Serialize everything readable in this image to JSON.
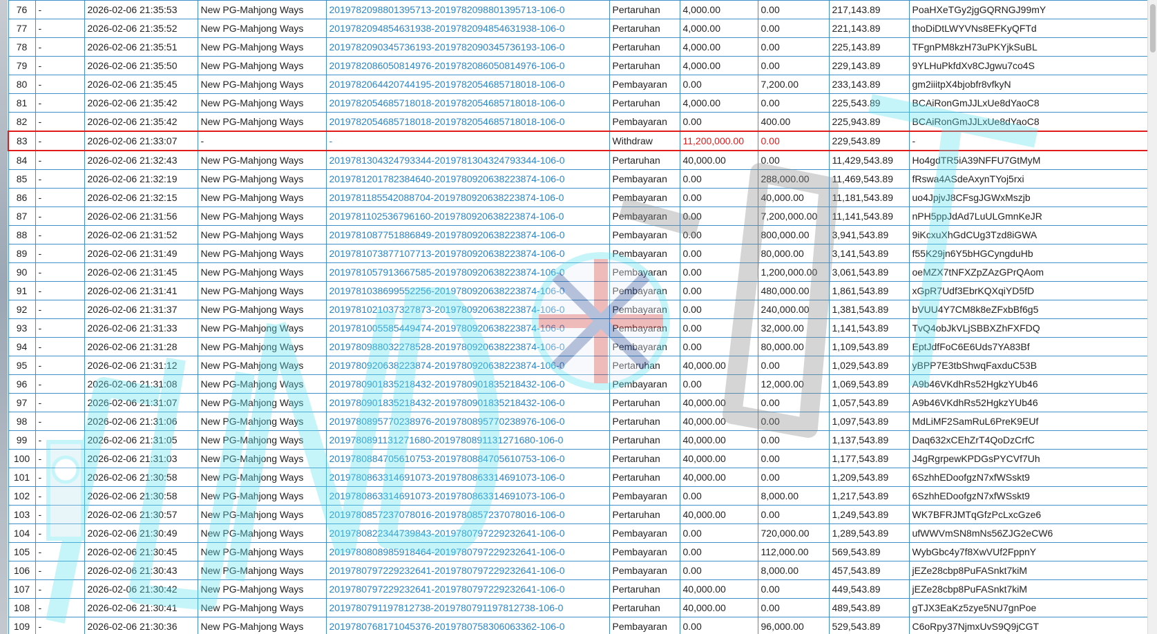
{
  "colors": {
    "border": "#3f8fc8",
    "link": "#2a86c8",
    "highlight": "#e01b1b",
    "watermark_fill": "#5fe3f0",
    "watermark_dark": "#7a7a7a"
  },
  "watermark": {
    "flag_icon": "union-jack-icon",
    "tower_icon": "big-ben-icon"
  },
  "rows": [
    {
      "no": "76",
      "f": "-",
      "dt": "2026-02-06 21:35:53",
      "game": "New PG-Mahjong Ways",
      "ref": "2019782098801395713-2019782098801395713-106-0",
      "type": "Pertaruhan",
      "debit": "4,000.00",
      "credit": "0.00",
      "bal": "217,143.89",
      "code": "PoaHXeTGy2jgGQRNGJ99mY"
    },
    {
      "no": "77",
      "f": "-",
      "dt": "2026-02-06 21:35:52",
      "game": "New PG-Mahjong Ways",
      "ref": "2019782094854631938-2019782094854631938-106-0",
      "type": "Pertaruhan",
      "debit": "4,000.00",
      "credit": "0.00",
      "bal": "221,143.89",
      "code": "thoDiDtLWYVNs8EFKyQFTd"
    },
    {
      "no": "78",
      "f": "-",
      "dt": "2026-02-06 21:35:51",
      "game": "New PG-Mahjong Ways",
      "ref": "2019782090345736193-2019782090345736193-106-0",
      "type": "Pertaruhan",
      "debit": "4,000.00",
      "credit": "0.00",
      "bal": "225,143.89",
      "code": "TFgnPM8kzH73uPKYjkSuBL"
    },
    {
      "no": "79",
      "f": "-",
      "dt": "2026-02-06 21:35:50",
      "game": "New PG-Mahjong Ways",
      "ref": "2019782086050814976-2019782086050814976-106-0",
      "type": "Pertaruhan",
      "debit": "4,000.00",
      "credit": "0.00",
      "bal": "229,143.89",
      "code": "9YLHuPkfdXv8CJgwu7co4S"
    },
    {
      "no": "80",
      "f": "-",
      "dt": "2026-02-06 21:35:45",
      "game": "New PG-Mahjong Ways",
      "ref": "2019782064420744195-2019782054685718018-106-0",
      "type": "Pembayaran",
      "debit": "0.00",
      "credit": "7,200.00",
      "bal": "233,143.89",
      "code": "gm2iiitpX4bjobfr8vfkyN"
    },
    {
      "no": "81",
      "f": "-",
      "dt": "2026-02-06 21:35:42",
      "game": "New PG-Mahjong Ways",
      "ref": "2019782054685718018-2019782054685718018-106-0",
      "type": "Pertaruhan",
      "debit": "4,000.00",
      "credit": "0.00",
      "bal": "225,543.89",
      "code": "BCAiRonGmJJLxUe8dYaoC8"
    },
    {
      "no": "82",
      "f": "-",
      "dt": "2026-02-06 21:35:42",
      "game": "New PG-Mahjong Ways",
      "ref": "2019782054685718018-2019782054685718018-106-0",
      "type": "Pembayaran",
      "debit": "0.00",
      "credit": "400.00",
      "bal": "225,943.89",
      "code": "BCAiRonGmJJLxUe8dYaoC8"
    },
    {
      "no": "83",
      "f": "-",
      "dt": "2026-02-06 21:33:07",
      "game": "-",
      "ref": "-",
      "type": "Withdraw",
      "debit": "11,200,000.00",
      "credit": "0.00",
      "bal": "229,543.89",
      "code": "-",
      "highlight": true
    },
    {
      "no": "84",
      "f": "-",
      "dt": "2026-02-06 21:32:43",
      "game": "New PG-Mahjong Ways",
      "ref": "2019781304324793344-2019781304324793344-106-0",
      "type": "Pertaruhan",
      "debit": "40,000.00",
      "credit": "0.00",
      "bal": "11,429,543.89",
      "code": "Ho4gdTR5iA39NFFU7GtMyM"
    },
    {
      "no": "85",
      "f": "-",
      "dt": "2026-02-06 21:32:19",
      "game": "New PG-Mahjong Ways",
      "ref": "2019781201782384640-2019780920638223874-106-0",
      "type": "Pembayaran",
      "debit": "0.00",
      "credit": "288,000.00",
      "bal": "11,469,543.89",
      "code": "fRswa4ASdeAxynTYoj5rxi"
    },
    {
      "no": "86",
      "f": "-",
      "dt": "2026-02-06 21:32:15",
      "game": "New PG-Mahjong Ways",
      "ref": "2019781185542088704-2019780920638223874-106-0",
      "type": "Pembayaran",
      "debit": "0.00",
      "credit": "40,000.00",
      "bal": "11,181,543.89",
      "code": "uo4JpjvJ8CFsgJGWxMszjb"
    },
    {
      "no": "87",
      "f": "-",
      "dt": "2026-02-06 21:31:56",
      "game": "New PG-Mahjong Ways",
      "ref": "2019781102536796160-2019780920638223874-106-0",
      "type": "Pembayaran",
      "debit": "0.00",
      "credit": "7,200,000.00",
      "bal": "11,141,543.89",
      "code": "nPH5ppJdAd7LuULGmnKeJR"
    },
    {
      "no": "88",
      "f": "-",
      "dt": "2026-02-06 21:31:52",
      "game": "New PG-Mahjong Ways",
      "ref": "2019781087751886849-2019780920638223874-106-0",
      "type": "Pembayaran",
      "debit": "0.00",
      "credit": "800,000.00",
      "bal": "3,941,543.89",
      "code": "9iKcxuXhGdCUg3Tzd8iGWA"
    },
    {
      "no": "89",
      "f": "-",
      "dt": "2026-02-06 21:31:49",
      "game": "New PG-Mahjong Ways",
      "ref": "2019781073877107713-2019780920638223874-106-0",
      "type": "Pembayaran",
      "debit": "0.00",
      "credit": "80,000.00",
      "bal": "3,141,543.89",
      "code": "f55K29jn6Y5bHGCyngduHb"
    },
    {
      "no": "90",
      "f": "-",
      "dt": "2026-02-06 21:31:45",
      "game": "New PG-Mahjong Ways",
      "ref": "2019781057913667585-2019780920638223874-106-0",
      "type": "Pembayaran",
      "debit": "0.00",
      "credit": "1,200,000.00",
      "bal": "3,061,543.89",
      "code": "oeMZX7tNFXZpZAzGPrQAom"
    },
    {
      "no": "91",
      "f": "-",
      "dt": "2026-02-06 21:31:41",
      "game": "New PG-Mahjong Ways",
      "ref": "2019781038699552256-2019780920638223874-106-0",
      "type": "Pembayaran",
      "debit": "0.00",
      "credit": "480,000.00",
      "bal": "1,861,543.89",
      "code": "xGpR7Udf3EbrKQXqiYD5fD"
    },
    {
      "no": "92",
      "f": "-",
      "dt": "2026-02-06 21:31:37",
      "game": "New PG-Mahjong Ways",
      "ref": "2019781021037327873-2019780920638223874-106-0",
      "type": "Pembayaran",
      "debit": "0.00",
      "credit": "240,000.00",
      "bal": "1,381,543.89",
      "code": "bVUU4Y7CM8k8eZFxbBf6g5"
    },
    {
      "no": "93",
      "f": "-",
      "dt": "2026-02-06 21:31:33",
      "game": "New PG-Mahjong Ways",
      "ref": "2019781005585449474-2019780920638223874-106-0",
      "type": "Pembayaran",
      "debit": "0.00",
      "credit": "32,000.00",
      "bal": "1,141,543.89",
      "code": "TvQ4obJkVLjSBBXZhFXFDQ"
    },
    {
      "no": "94",
      "f": "-",
      "dt": "2026-02-06 21:31:28",
      "game": "New PG-Mahjong Ways",
      "ref": "2019780988032278528-2019780920638223874-106-0",
      "type": "Pembayaran",
      "debit": "0.00",
      "credit": "80,000.00",
      "bal": "1,109,543.89",
      "code": "EptJdfFoC6E6Uds7YA83Bf"
    },
    {
      "no": "95",
      "f": "-",
      "dt": "2026-02-06 21:31:12",
      "game": "New PG-Mahjong Ways",
      "ref": "2019780920638223874-2019780920638223874-106-0",
      "type": "Pertaruhan",
      "debit": "40,000.00",
      "credit": "0.00",
      "bal": "1,029,543.89",
      "code": "yBPP7E3tbShwqFaxduC53B"
    },
    {
      "no": "96",
      "f": "-",
      "dt": "2026-02-06 21:31:08",
      "game": "New PG-Mahjong Ways",
      "ref": "2019780901835218432-2019780901835218432-106-0",
      "type": "Pembayaran",
      "debit": "0.00",
      "credit": "12,000.00",
      "bal": "1,069,543.89",
      "code": "A9b46VKdhRs52HgkzYUb46"
    },
    {
      "no": "97",
      "f": "-",
      "dt": "2026-02-06 21:31:07",
      "game": "New PG-Mahjong Ways",
      "ref": "2019780901835218432-2019780901835218432-106-0",
      "type": "Pertaruhan",
      "debit": "40,000.00",
      "credit": "0.00",
      "bal": "1,057,543.89",
      "code": "A9b46VKdhRs52HgkzYUb46"
    },
    {
      "no": "98",
      "f": "-",
      "dt": "2026-02-06 21:31:06",
      "game": "New PG-Mahjong Ways",
      "ref": "2019780895770238976-2019780895770238976-106-0",
      "type": "Pertaruhan",
      "debit": "40,000.00",
      "credit": "0.00",
      "bal": "1,097,543.89",
      "code": "MdLiMF2SamRuL6PreK9EUf"
    },
    {
      "no": "99",
      "f": "-",
      "dt": "2026-02-06 21:31:05",
      "game": "New PG-Mahjong Ways",
      "ref": "2019780891131271680-2019780891131271680-106-0",
      "type": "Pertaruhan",
      "debit": "40,000.00",
      "credit": "0.00",
      "bal": "1,137,543.89",
      "code": "Daq632xCEhZrT4QoDzCrfC"
    },
    {
      "no": "100",
      "f": "-",
      "dt": "2026-02-06 21:31:03",
      "game": "New PG-Mahjong Ways",
      "ref": "2019780884705610753-2019780884705610753-106-0",
      "type": "Pertaruhan",
      "debit": "40,000.00",
      "credit": "0.00",
      "bal": "1,177,543.89",
      "code": "J4gRgrpewKPDGsPYCVf7Uh"
    },
    {
      "no": "101",
      "f": "-",
      "dt": "2026-02-06 21:30:58",
      "game": "New PG-Mahjong Ways",
      "ref": "2019780863314691073-2019780863314691073-106-0",
      "type": "Pertaruhan",
      "debit": "40,000.00",
      "credit": "0.00",
      "bal": "1,209,543.89",
      "code": "6SzhhEDoofgzN7xfWSskt9"
    },
    {
      "no": "102",
      "f": "-",
      "dt": "2026-02-06 21:30:58",
      "game": "New PG-Mahjong Ways",
      "ref": "2019780863314691073-2019780863314691073-106-0",
      "type": "Pembayaran",
      "debit": "0.00",
      "credit": "8,000.00",
      "bal": "1,217,543.89",
      "code": "6SzhhEDoofgzN7xfWSskt9"
    },
    {
      "no": "103",
      "f": "-",
      "dt": "2026-02-06 21:30:57",
      "game": "New PG-Mahjong Ways",
      "ref": "2019780857237078016-2019780857237078016-106-0",
      "type": "Pertaruhan",
      "debit": "40,000.00",
      "credit": "0.00",
      "bal": "1,249,543.89",
      "code": "WK7BFRJMTqGfzPcLxcGze6"
    },
    {
      "no": "104",
      "f": "-",
      "dt": "2026-02-06 21:30:49",
      "game": "New PG-Mahjong Ways",
      "ref": "2019780822344739843-2019780797229232641-106-0",
      "type": "Pembayaran",
      "debit": "0.00",
      "credit": "720,000.00",
      "bal": "1,289,543.89",
      "code": "ufWWVmSN8mNs56ZJG2eCW6"
    },
    {
      "no": "105",
      "f": "-",
      "dt": "2026-02-06 21:30:45",
      "game": "New PG-Mahjong Ways",
      "ref": "2019780808985918464-2019780797229232641-106-0",
      "type": "Pembayaran",
      "debit": "0.00",
      "credit": "112,000.00",
      "bal": "569,543.89",
      "code": "WybGbc4y7f8XwVUf2FppnY"
    },
    {
      "no": "106",
      "f": "-",
      "dt": "2026-02-06 21:30:43",
      "game": "New PG-Mahjong Ways",
      "ref": "2019780797229232641-2019780797229232641-106-0",
      "type": "Pembayaran",
      "debit": "0.00",
      "credit": "8,000.00",
      "bal": "457,543.89",
      "code": "jEZe28cbp8PuFASnkt7kiM"
    },
    {
      "no": "107",
      "f": "-",
      "dt": "2026-02-06 21:30:42",
      "game": "New PG-Mahjong Ways",
      "ref": "2019780797229232641-2019780797229232641-106-0",
      "type": "Pertaruhan",
      "debit": "40,000.00",
      "credit": "0.00",
      "bal": "449,543.89",
      "code": "jEZe28cbp8PuFASnkt7kiM"
    },
    {
      "no": "108",
      "f": "-",
      "dt": "2026-02-06 21:30:41",
      "game": "New PG-Mahjong Ways",
      "ref": "2019780791197812738-2019780791197812738-106-0",
      "type": "Pertaruhan",
      "debit": "40,000.00",
      "credit": "0.00",
      "bal": "489,543.89",
      "code": "gTJX3EaKz5zye5NU7gnPoe"
    },
    {
      "no": "109",
      "f": "-",
      "dt": "2026-02-06 21:30:36",
      "game": "New PG-Mahjong Ways",
      "ref": "2019780768171045376-2019780758306063362-106-0",
      "type": "Pembayaran",
      "debit": "0.00",
      "credit": "96,000.00",
      "bal": "529,543.89",
      "code": "C6oRpy37NjmxUvS9Q9jCGT"
    }
  ]
}
